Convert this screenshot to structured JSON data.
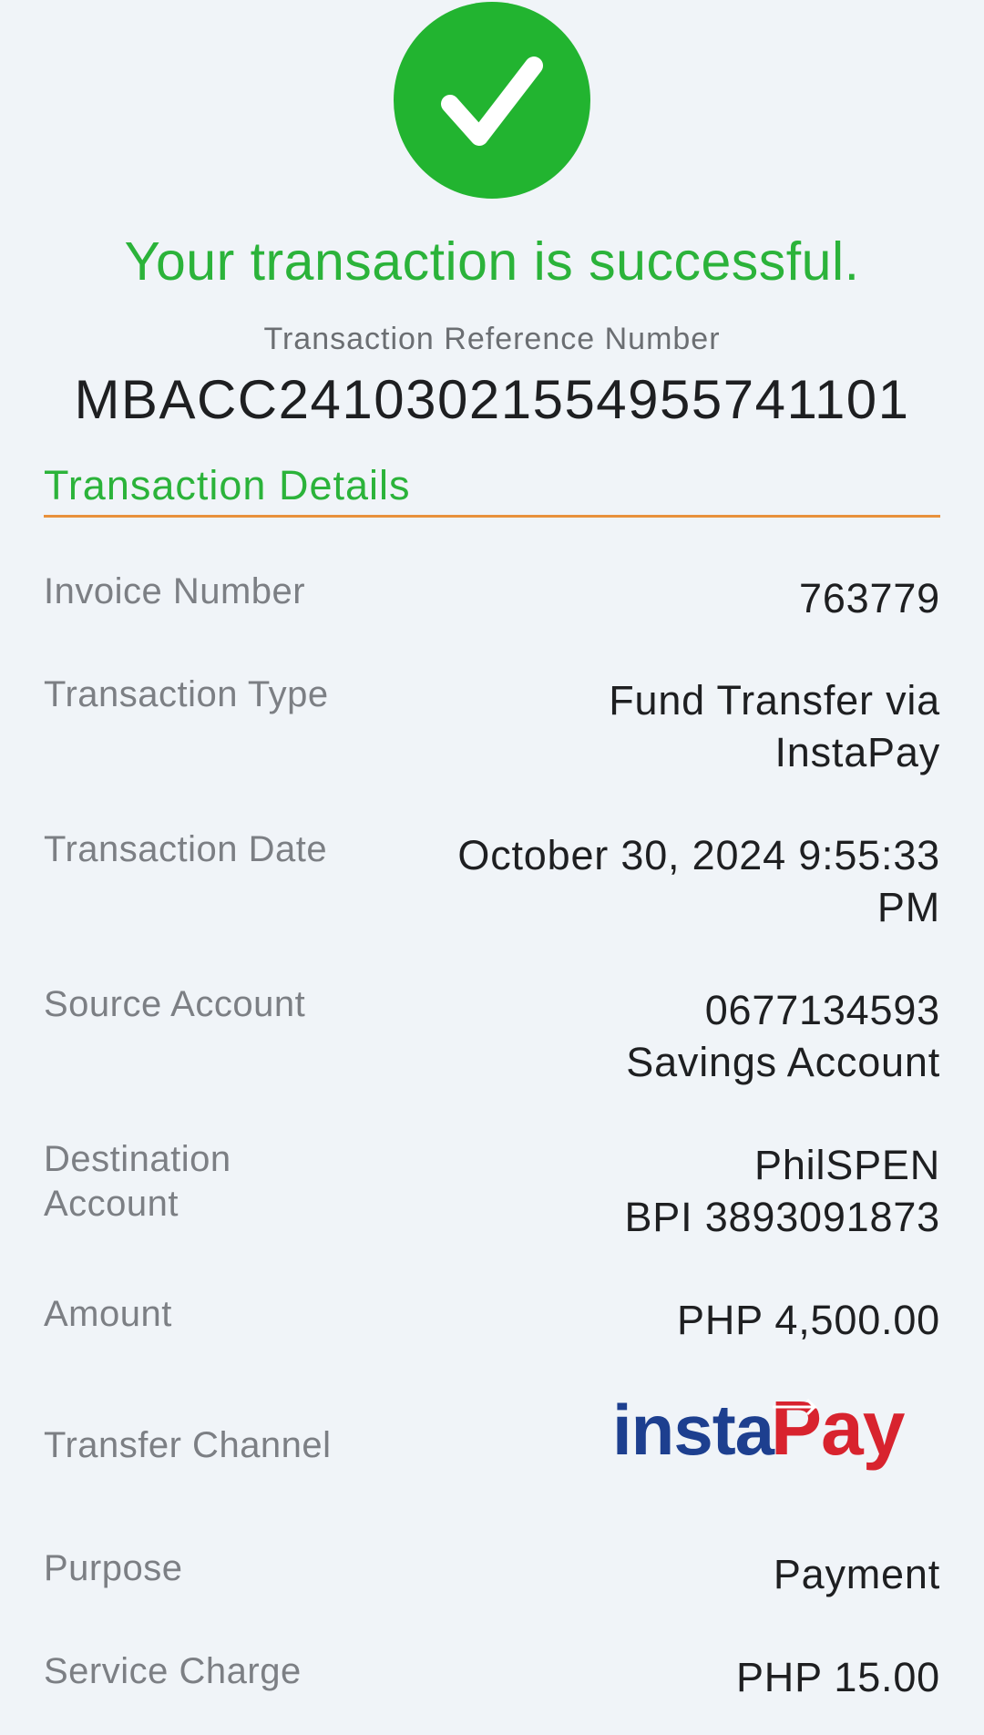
{
  "header": {
    "status_icon": "checkmark-icon",
    "success_message": "Your transaction is successful.",
    "reference_label": "Transaction Reference Number",
    "reference_number": "MBACC24103021554955741101"
  },
  "details": {
    "section_title": "Transaction Details",
    "invoice_number": {
      "label": "Invoice Number",
      "value": "763779"
    },
    "transaction_type": {
      "label": "Transaction Type",
      "value_line1": "Fund Transfer via",
      "value_line2": "InstaPay"
    },
    "transaction_date": {
      "label": "Transaction Date",
      "value_line1": "October 30, 2024 9:55:33",
      "value_line2": "PM"
    },
    "source_account": {
      "label": "Source Account",
      "value_line1": "0677134593",
      "value_line2": "Savings Account"
    },
    "destination_account": {
      "label_line1": "Destination",
      "label_line2": "Account",
      "value_line1": "PhilSPEN",
      "value_line2": "BPI 3893091873"
    },
    "amount": {
      "label": "Amount",
      "value": "PHP 4,500.00"
    },
    "transfer_channel": {
      "label": "Transfer Channel",
      "logo_text_left": "insta",
      "logo_text_right": "Pay"
    },
    "purpose": {
      "label": "Purpose",
      "value": "Payment"
    },
    "service_charge": {
      "label": "Service Charge",
      "value": "PHP 15.00"
    }
  },
  "colors": {
    "success_green": "#22b430",
    "accent_orange": "#e8913c",
    "instapay_blue": "#1d3f8f",
    "instapay_red": "#d8232e"
  }
}
